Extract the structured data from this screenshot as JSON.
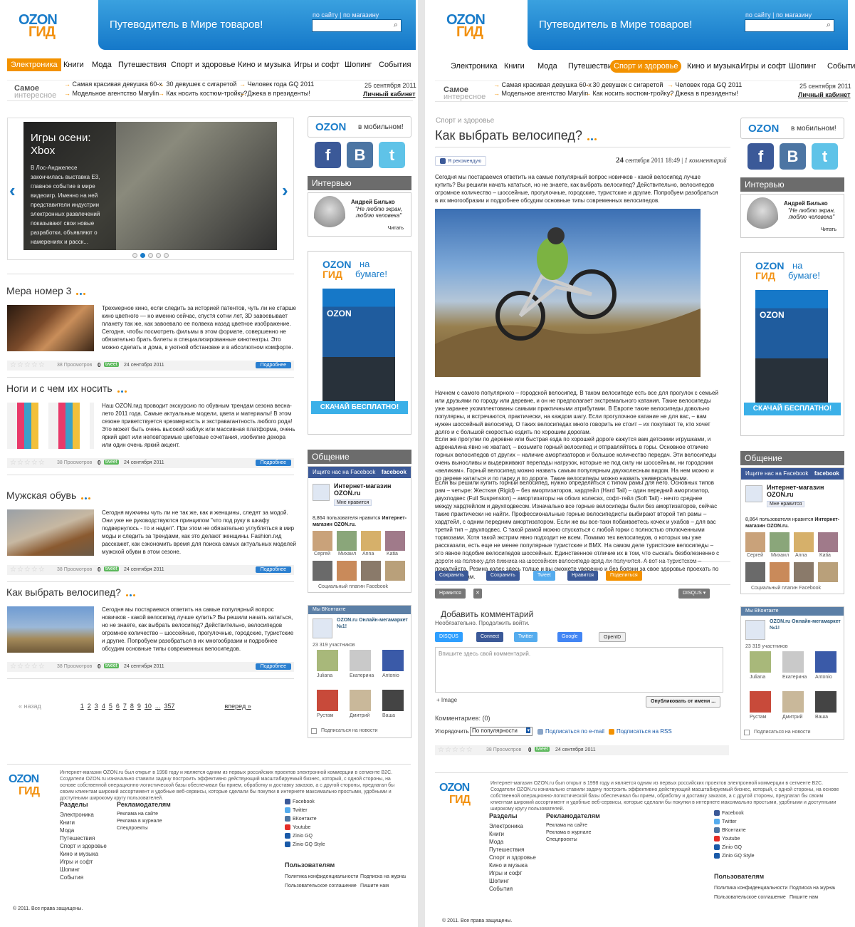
{
  "brand": {
    "logo_top": "OZON",
    "logo_bottom": "ГИД",
    "tagline": "Путеводитель в Мире товаров!",
    "search_links": "по сайту | по магазину"
  },
  "nav_left": [
    "Электроника",
    "Книги",
    "Мода",
    "Путешествия",
    "Спорт и здоровье",
    "Кино и музыка",
    "Игры и софт",
    "Шопинг",
    "События"
  ],
  "nav_right": [
    "Электроника",
    "Книги",
    "Мода",
    "Путешествия",
    "Спорт и здоровье",
    "Кино и музыка",
    "Игры и софт",
    "Шопинг",
    "События"
  ],
  "strip": {
    "title_top": "Самое",
    "title_bottom": "интересное",
    "links": [
      "Самая красивая девушка 60-х",
      "Модельное агентство Marylin",
      "30 девушек с сигаретой",
      "Как носить костюм-тройку?",
      "Человек года GQ 2011",
      "Джека в президенты!"
    ],
    "date": "25 сентября 2011",
    "cabinet": "Личный кабинет"
  },
  "slider": {
    "title": "Игры осени: Xbox",
    "text": "В Лос-Анджелесе закончилась выставка E3, главное событие в мире видеоигр. Именно на ней представители индустрии электронных развлечений показывают свои новые разработки, объявляют о намерениях и расск..."
  },
  "articles": [
    {
      "title": "Мера номер 3",
      "text": "Трехмерное кино, если следить за историей патентов, чуть ли не старше кино цветного — но именно сейчас, спустя сотни лет, 3D завоевывает планету так же, как завоевало ее полвека назад цветное изображение. Сегодня, чтобы посмотреть фильмы в этом формате, совершенно не обязательно брать билеты в специализированные кинотеатры. Это можно сделать и дома, в уютной обстановке и в абсолютном комфорте.",
      "views": "38 Просмотров",
      "comments": "0",
      "date": "24 сентября 2011"
    },
    {
      "title": "Ноги и с чем их носить",
      "text": "Наш OZON.гид проводит экскурсию по обувным трендам сезона весна-лето 2011 года. Самые актуальные модели, цвета и материалы! В этом сезоне приветствуется чрезмерность и экстравагантность любого рода! Это может быть очень высокий каблук или массивная платформа, очень яркий цвет или неповторимые цветовые сочетания, изобилие декора или один очень яркий акцент.",
      "views": "38 Просмотров",
      "comments": "0",
      "date": "24 сентября 2011"
    },
    {
      "title": "Мужская обувь",
      "text": "Сегодня мужчины чуть ли не так же, как и женщины, следят за модой. Они уже не руководствуются принципом \"что под руку в шкафу подвернулось - то и надел\". При этом не обязательно углубляться в мир моды и следить за трендами, как это делают женщины. Fashion.гид расскажет, как сэкономить время для поиска самых актуальных моделей мужской обуви в этом сезоне.",
      "views": "38 Просмотров",
      "comments": "0",
      "date": "24 сентября 2011"
    },
    {
      "title": "Как выбрать велосипед?",
      "text": "Сегодня мы постараемся ответить на самые популярный вопрос новичков - какой велосипед лучше купить? Вы решили начать кататься, но не знаете, как выбрать велосипед? Действительно, велосипедов огромное количество – шоссейные, прогулочные, городские, туристские и другие. Попробуем разобраться в их многообразии и подробнее обсудим основные типы современных велосипедов.",
      "views": "38 Просмотров",
      "comments": "0",
      "date": "24 сентября 2011"
    }
  ],
  "meta_labels": {
    "tweet": "tweet",
    "more": "Подробнее"
  },
  "pager": {
    "prev": "« назад",
    "pages": [
      "1",
      "2",
      "3",
      "4",
      "5",
      "6",
      "7",
      "8",
      "9",
      "10",
      "...",
      "357"
    ],
    "next": "вперед »"
  },
  "sidebar": {
    "mobile_logo": "OZON",
    "mobile_text": "в мобильном!",
    "interview_title": "Интервью",
    "interview_name": "Андрей Билько",
    "interview_quote": "\"Не люблю экран, люблю человека\"",
    "interview_read": "Читать",
    "paper_top": "OZON",
    "paper_mid": "на",
    "paper_bottom": "бумаге!",
    "paper_cta": "СКАЧАЙ БЕСПЛАТНО!",
    "social_title": "Общение",
    "fb_search": "Ищите нас на Facebook",
    "fb_brand": "facebook",
    "fb_page": "Интернет-магазин OZON.ru",
    "fb_like": "Мне нравится",
    "fb_count": "8,864 пользователя нравится",
    "fb_count_bold": "Интернет-магазин OZON.ru.",
    "fb_people": [
      "Сергей",
      "Михаил",
      "Anna",
      "Katia"
    ],
    "fb_plugin": "Социальный плагин Facebook",
    "vk_title": "Мы ВКонтакте",
    "vk_page": "OZON.ru Онлайн-мегамаркет №1!",
    "vk_count": "23 319 участников",
    "vk_people": [
      "Juliana",
      "Екатерина",
      "Antonio",
      "Рустам",
      "Дмитрий",
      "Ваша"
    ],
    "vk_subscribe": "Подписаться на новости"
  },
  "post": {
    "category": "Спорт и здоровье",
    "title": "Как выбрать велосипед?",
    "recommend": "Я рекомендую",
    "date_day": "24",
    "date_rest": "сентября 2011 18:49",
    "comments_link": "1 комментарий",
    "lead": "Сегодня мы постараемся ответить на самые популярный вопрос новичков - какой велосипед лучше купить? Вы решили начать кататься, но не знаете, как выбрать велосипед? Действительно, велосипедов огромное количество – шоссейные, прогулочные, городские, туристские и другие. Попробуем разобраться в их многообразии и подробнее обсудим основные типы современных велосипедов.",
    "p1": "Начнем с самого популярного – городской велосипед. В таком велосипеде есть все для прогулок с семьей или друзьями по городу или деревне, и он не предполагает экстремального катания. Такие велосипеды уже заранее укомплектованы самыми практичными атрибутами. В Европе такие велосипеды довольно популярны, и встречаются, практически, на каждом шагу. Если прогулочное катание не для вас, – вам нужен шоссейный велосипед. О таких велосипедах много говорить не стоит – их покупают те, кто хочет долго и с большой скоростью ездить по хорошим дорогам.",
    "p2": "Если же прогулки по деревне или быстрая езда по хорошей дороге кажутся вам детскими игрушками, и адреналина явно не хватает, – возьмите горный велосипед и отправляйтесь в горы. Основное отличие горных велосипедов от других – наличие амортизаторов и большое количество передач. Эти велосипеды очень выносливы и выдерживают перепады нагрузок, которые не под силу ни шоссейным, ни городским «великам». Горный велосипед можно назвать самым популярным двухколесным видом. На нем можно и по дереве кататься и по парку и по дороге. Такие велосипеды можно назвать универсальными.",
    "p3": "Если вы решили купить горный велосипед, нужно определиться с типом рамы для него. Основных типов рам – четыре: Жесткая (Rigid) – без амортизаторов, хардтейл (Hard Tail) – один передний амортизатор, двухподвес (Full Suspension) – амортизаторы на обоих колесах, софт-тейл (Soft Tail) - нечто среднее между хардтейлом и двухподвесом. Изначально все горные велосипеды были без амортизаторов, сейчас такие практически не найти. Профессиональные горные велосипедисты выбирают второй тип рамы – хардтейл, с одним передним амортизатором. Если же вы все-таки побаиваетесь кочек и ухабов – для вас третий тип – двухподвес. С такой рамой можно спускаться с любой горки с полностью отключенными тормозами. Хотя такой экстрим явно подходит не всем. Помимо тех велосипедов, о которых мы уже рассказали, есть еще не менее популярные туристские и BMX. На самом деле туристские велосипеды – это явное подобие велосипедов шоссейных. Единственное отличие их в том, что сыскать безболезненно с дороги на полянку для пикника на шоссейном велосипеде вряд ли получится. А вот на туристском – пожалуйста. Резина колес здесь толще и вы сможете уверенно и без боязни за свое здоровье проехать по ямам и кочкам.",
    "share": [
      "Сохранить",
      "Сохранить",
      "Tweet",
      "Нравится",
      "Поделиться"
    ],
    "like_small": "Нравится",
    "disqus": "DISQUS",
    "add_comment": "Добавить комментарий",
    "need_login": "Необязательно. Продолжить войти.",
    "login_buttons": [
      "DISQUS",
      "Connect",
      "Twitter",
      "Google",
      "OpenID"
    ],
    "comment_placeholder": "Впишите здесь свой комментарий.",
    "image_link": "+ Image",
    "publish": "Опубликовать от имени ...",
    "comments_count": "Комментариев: (0)",
    "sort_label": "Упорядочить",
    "sort_value": "По популярности",
    "sub_email": "Подписаться по e-mail",
    "sub_rss": "Подписаться на RSS",
    "views": "38 Просмотров",
    "comments": "0",
    "date": "24 сентября 2011"
  },
  "footer": {
    "about": "Интернет-магазин OZON.ru был открыт в 1998 году и является одним из первых российских проектов электронной коммерции в сегменте B2C. Создатели OZON.ru изначально ставили задачу построить эффективно действующий масштабируемый бизнес, который, с одной стороны, на основе собственной операционно-логистической базы обеспечивал бы прием, обработку и доставку заказов, а с другой стороны, предлагал бы своим клиентам широкий ассортимент и удобные веб-сервисы, которые сделали бы покупки в интернете максимально простыми, удобными и доступными широкому кругу пользователей.",
    "sections_title": "Разделы",
    "sections": [
      "Электроника",
      "Книги",
      "Мода",
      "Путешествия",
      "Спорт и здоровье",
      "Кино и музыка",
      "Игры и софт",
      "Шопинг",
      "События"
    ],
    "ads_title": "Рекламодателям",
    "ads": [
      "Реклама на сайте",
      "Реклама в журнале",
      "Спецпроекты"
    ],
    "social": [
      "Facebook",
      "Twitter",
      "ВКонтакте",
      "Youtube",
      "Zinio GQ",
      "Zinio GQ Style"
    ],
    "users_title": "Пользователям",
    "users": [
      "Политика конфиденциальности",
      "Подписка на журнал",
      "Пользовательское соглашение",
      "Пишите нам"
    ],
    "copyright": "© 2011. Все права защищены."
  },
  "colors": {
    "accent": "#f39200",
    "blue": "#1a7cc9",
    "fb": "#3b5998"
  }
}
